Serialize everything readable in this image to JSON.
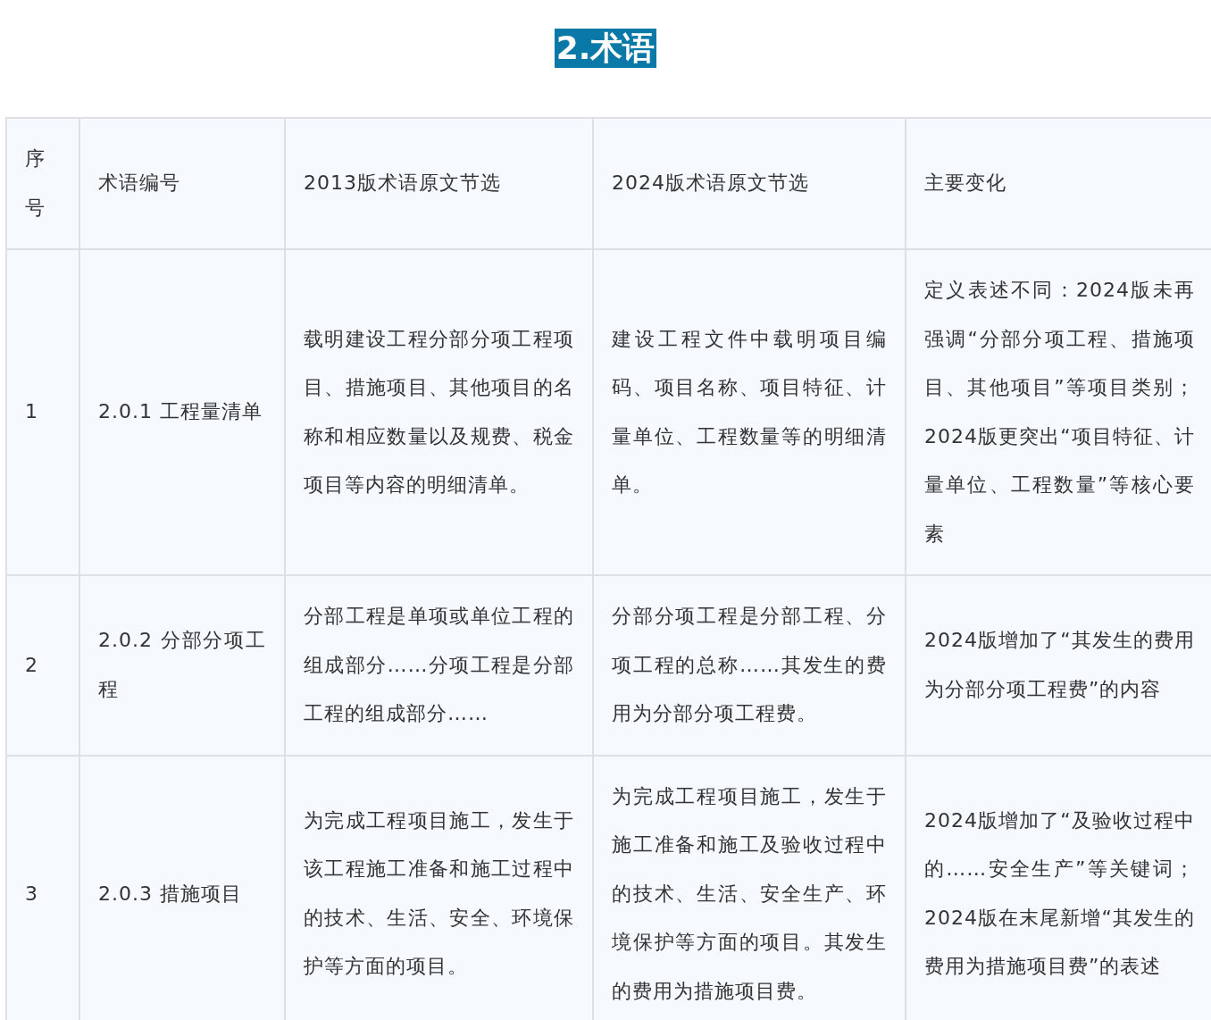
{
  "title": "2.术语",
  "table": {
    "columns": [
      "序号",
      "术语编号",
      "2013版术语原文节选",
      "2024版术语原文节选",
      "主要变化"
    ],
    "rows": [
      {
        "cells": [
          "1",
          "2.0.1 工程量清单",
          "载明建设工程分部分项工程项目、措施项目、其他项目的名称和相应数量以及规费、税金项目等内容的明细清单。",
          "建设工程文件中载明项目编码、项目名称、项目特征、计量单位、工程数量等的明细清单。",
          "定义表述不同：2024版未再强调“分部分项工程、措施项目、其他项目”等项目类别；2024版更突出“项目特征、计量单位、工程数量”等核心要素"
        ]
      },
      {
        "cells": [
          "2",
          "2.0.2 分部分项工程",
          "分部工程是单项或单位工程的组成部分……分项工程是分部工程的组成部分……",
          "分部分项工程是分部工程、分项工程的总称……其发生的费用为分部分项工程费。",
          "2024版增加了“其发生的费用为分部分项工程费”的内容"
        ]
      },
      {
        "cells": [
          "3",
          "2.0.3 措施项目",
          "为完成工程项目施工，发生于该工程施工准备和施工过程中的技术、生活、安全、环境保护等方面的项目。",
          "为完成工程项目施工，发生于施工准备和施工及验收过程中的技术、生活、安全生产、环境保护等方面的项目。其发生的费用为措施项目费。",
          "2024版增加了“及验收过程中的……安全生产”等关键词；2024版在末尾新增“其发生的费用为措施项目费”的表述"
        ]
      }
    ]
  }
}
